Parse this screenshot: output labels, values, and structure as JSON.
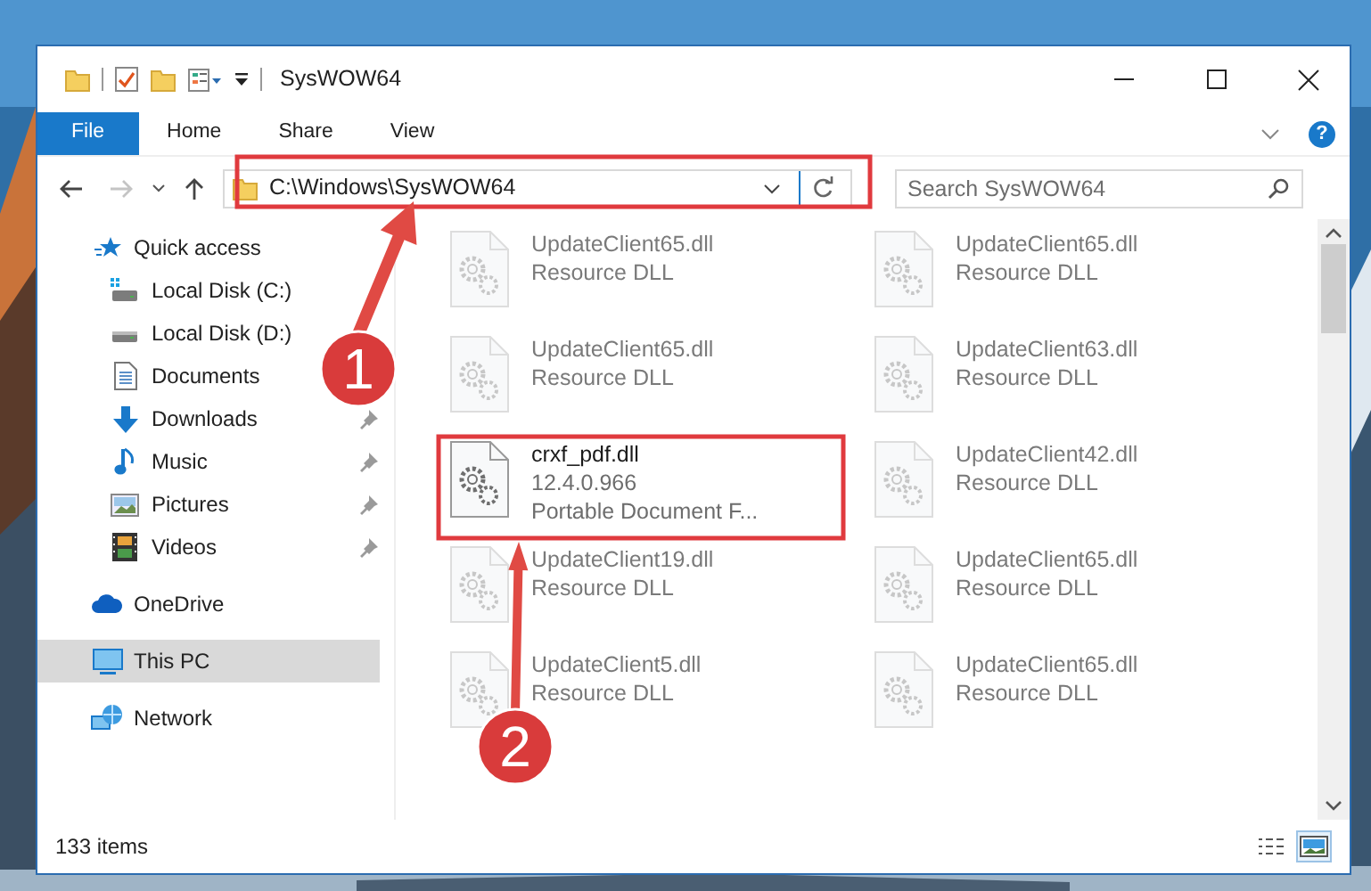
{
  "window": {
    "title": "SysWOW64"
  },
  "ribbon": {
    "tabs": [
      {
        "label": "File",
        "kind": "file"
      },
      {
        "label": "Home",
        "kind": "tab"
      },
      {
        "label": "Share",
        "kind": "tab"
      },
      {
        "label": "View",
        "kind": "tab"
      }
    ],
    "help": "?"
  },
  "address": {
    "back_enabled": true,
    "forward_enabled": false,
    "path": "C:\\Windows\\SysWOW64"
  },
  "search": {
    "placeholder": "Search SysWOW64"
  },
  "nav": [
    {
      "label": "Quick access",
      "kind": "star",
      "selected": false,
      "children": [
        {
          "label": "Local Disk (C:)",
          "kind": "disk-c",
          "pinned": false,
          "selected": false
        },
        {
          "label": "Local Disk (D:)",
          "kind": "disk",
          "pinned": false,
          "selected": false
        },
        {
          "label": "Documents",
          "kind": "documents",
          "pinned": false,
          "selected": false
        },
        {
          "label": "Downloads",
          "kind": "downloads",
          "pinned": true,
          "selected": false
        },
        {
          "label": "Music",
          "kind": "music",
          "pinned": true,
          "selected": false
        },
        {
          "label": "Pictures",
          "kind": "pictures",
          "pinned": true,
          "selected": false
        },
        {
          "label": "Videos",
          "kind": "videos",
          "pinned": true,
          "selected": false
        }
      ]
    },
    {
      "label": "OneDrive",
      "kind": "cloud",
      "selected": false
    },
    {
      "label": "This PC",
      "kind": "pc",
      "selected": true
    },
    {
      "label": "Network",
      "kind": "network",
      "selected": false
    }
  ],
  "files": [
    {
      "name": "UpdateClient65.dll",
      "lines": [
        "Resource DLL"
      ],
      "blurred": true
    },
    {
      "name": "UpdateClient65.dll",
      "lines": [
        "Resource DLL"
      ],
      "blurred": true
    },
    {
      "name": "UpdateClient65.dll",
      "lines": [
        "Resource DLL"
      ],
      "blurred": true
    },
    {
      "name": "UpdateClient63.dll",
      "lines": [
        "Resource DLL"
      ],
      "blurred": true
    },
    {
      "name": "crxf_pdf.dll",
      "lines": [
        "12.4.0.966",
        "Portable Document F..."
      ],
      "blurred": false
    },
    {
      "name": "UpdateClient42.dll",
      "lines": [
        "Resource DLL"
      ],
      "blurred": true
    },
    {
      "name": "UpdateClient19.dll",
      "lines": [
        "Resource DLL"
      ],
      "blurred": true
    },
    {
      "name": "UpdateClient65.dll",
      "lines": [
        "Resource DLL"
      ],
      "blurred": true
    },
    {
      "name": "UpdateClient5.dll",
      "lines": [
        "Resource DLL"
      ],
      "blurred": true
    },
    {
      "name": "UpdateClient65.dll",
      "lines": [
        "Resource DLL"
      ],
      "blurred": true
    }
  ],
  "status_bar": {
    "count": "133 items",
    "views": [
      {
        "kind": "details",
        "selected": false
      },
      {
        "kind": "large-icons",
        "selected": true
      }
    ]
  },
  "annotations": [
    {
      "number": "1"
    },
    {
      "number": "2"
    }
  ]
}
